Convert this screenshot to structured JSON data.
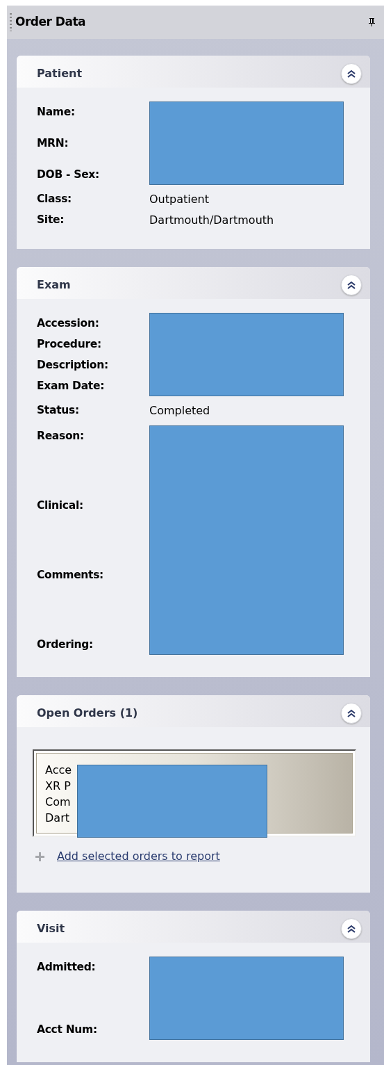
{
  "panel": {
    "title": "Order Data"
  },
  "sections": [
    {
      "kind": "fields",
      "title": "Patient",
      "expanded": true,
      "fields": [
        {
          "label": "Name:",
          "redacted": true
        },
        {
          "label": "MRN:",
          "redacted": true
        },
        {
          "label": "DOB - Sex:",
          "redacted": true
        },
        {
          "label": "Class:",
          "value": "Outpatient",
          "redacted": false
        },
        {
          "label": "Site:",
          "value": "Dartmouth/Dartmouth",
          "redacted": false
        }
      ]
    },
    {
      "kind": "fields",
      "title": "Exam",
      "expanded": true,
      "fields": [
        {
          "label": "Accession:",
          "redacted": true
        },
        {
          "label": "Procedure:",
          "redacted": true
        },
        {
          "label": "Description:",
          "redacted": true
        },
        {
          "label": "Exam Date:",
          "redacted": true
        },
        {
          "label": "Status:",
          "value": "Completed",
          "redacted": false
        },
        {
          "label": "Reason:",
          "redacted": true
        },
        {
          "label": "Clinical:",
          "redacted": true
        },
        {
          "label": "Comments:",
          "redacted": true
        },
        {
          "label": "Ordering:",
          "redacted": true
        }
      ]
    },
    {
      "kind": "orders",
      "title": "Open Orders (1)",
      "expanded": true,
      "lines": [
        "Acce",
        "XR P",
        "Com",
        "Dart"
      ],
      "link": "Add selected orders to report"
    },
    {
      "kind": "fields",
      "title": "Visit",
      "expanded": true,
      "fields": [
        {
          "label": "Admitted:",
          "redacted": true
        },
        {
          "label": "Acct Num:",
          "redacted": true
        }
      ]
    }
  ]
}
